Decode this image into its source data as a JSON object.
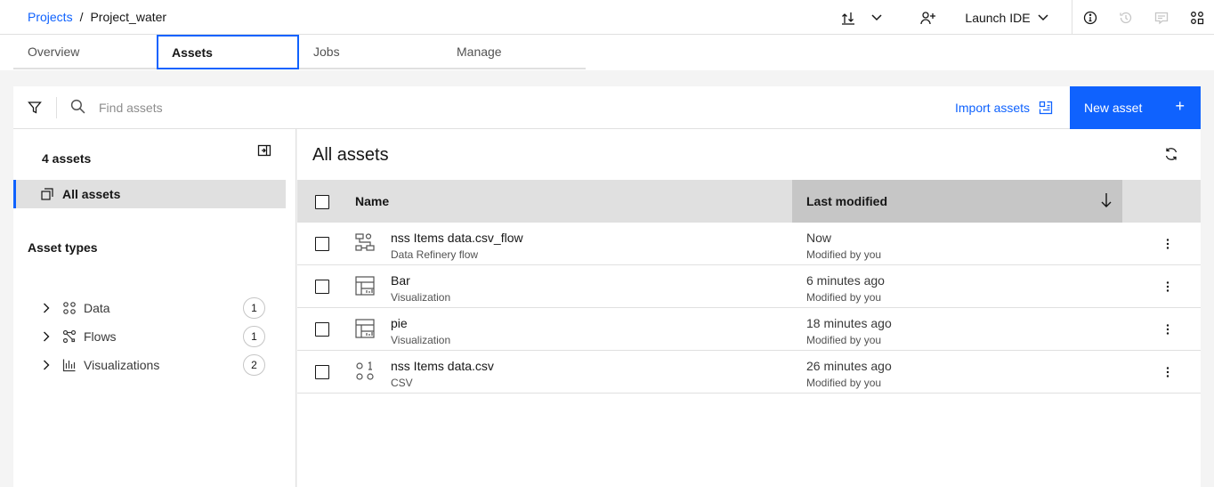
{
  "breadcrumb": {
    "parent": "Projects",
    "separator": "/",
    "current": "Project_water"
  },
  "header": {
    "launch_ide": "Launch IDE"
  },
  "tabs": [
    {
      "label": "Overview"
    },
    {
      "label": "Assets"
    },
    {
      "label": "Jobs"
    },
    {
      "label": "Manage"
    }
  ],
  "toolbar": {
    "search_placeholder": "Find assets",
    "import_label": "Import assets",
    "new_label": "New asset",
    "new_plus": "+"
  },
  "sidebar": {
    "count": "4 assets",
    "all_assets": "All assets",
    "types_title": "Asset types",
    "types": [
      {
        "label": "Data",
        "count": "1",
        "icon": "data-icon"
      },
      {
        "label": "Flows",
        "count": "1",
        "icon": "flows-icon"
      },
      {
        "label": "Visualizations",
        "count": "2",
        "icon": "visualization-icon"
      }
    ]
  },
  "main": {
    "title": "All assets",
    "columns": {
      "name": "Name",
      "modified": "Last modified"
    },
    "rows": [
      {
        "name": "nss Items data.csv_flow",
        "type": "Data Refinery flow",
        "modified": "Now",
        "by": "Modified by you",
        "icon": "flow-icon"
      },
      {
        "name": "Bar",
        "type": "Visualization",
        "modified": "6 minutes ago",
        "by": "Modified by you",
        "icon": "visualization-icon"
      },
      {
        "name": "pie",
        "type": "Visualization",
        "modified": "18 minutes ago",
        "by": "Modified by you",
        "icon": "visualization-icon"
      },
      {
        "name": "nss Items data.csv",
        "type": "CSV",
        "modified": "26 minutes ago",
        "by": "Modified by you",
        "icon": "data-icon"
      }
    ]
  },
  "colors": {
    "accent": "#0f62fe",
    "selected_bg": "#e0e0e0",
    "header_sorted_bg": "#c6c6c6"
  }
}
